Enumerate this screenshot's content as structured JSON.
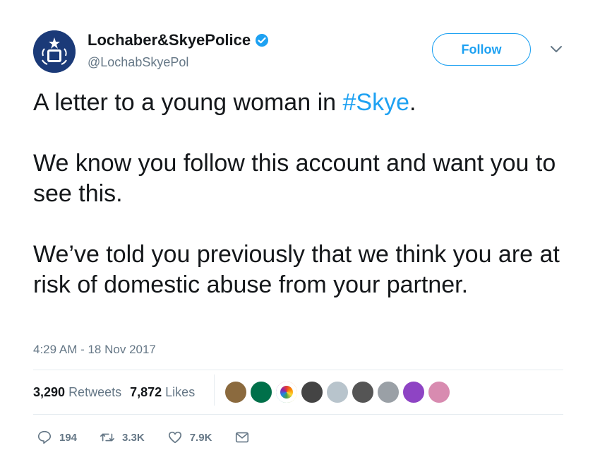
{
  "account": {
    "display_name": "Lochaber&SkyePolice",
    "handle": "@LochabSkyePol",
    "verified_icon": "verified-badge-icon"
  },
  "follow_label": "Follow",
  "tweet": {
    "line1_prefix": "A letter to a young woman in ",
    "hashtag": "#Skye",
    "line1_suffix": ".",
    "para2": "We know you follow this account and want you to see this.",
    "para3": "We’ve told you previously that we think you are at risk of domestic abuse from your partner."
  },
  "timestamp": "4:29 AM - 18 Nov 2017",
  "stats": {
    "retweets_count": "3,290",
    "retweets_label": "Retweets",
    "likes_count": "7,872",
    "likes_label": "Likes"
  },
  "likers": [
    "#8b6a3e",
    "#00704a",
    "#ffffff",
    "#444444",
    "#b8c4cc",
    "#555555",
    "#9aa0a6",
    "#8e44c4",
    "#d88bb0"
  ],
  "actions": {
    "replies": "194",
    "retweets": "3.3K",
    "likes": "7.9K"
  },
  "colors": {
    "accent": "#1da1f2",
    "muted": "#657786",
    "text": "#14171a"
  }
}
